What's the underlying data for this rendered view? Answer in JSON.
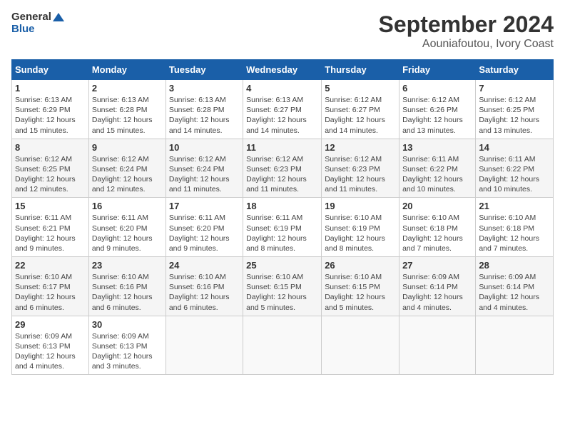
{
  "header": {
    "logo_line1": "General",
    "logo_line2": "Blue",
    "title": "September 2024",
    "subtitle": "Aouniafoutou, Ivory Coast"
  },
  "calendar": {
    "days_of_week": [
      "Sunday",
      "Monday",
      "Tuesday",
      "Wednesday",
      "Thursday",
      "Friday",
      "Saturday"
    ],
    "weeks": [
      [
        {
          "day": 1,
          "sunrise": "6:13 AM",
          "sunset": "6:29 PM",
          "daylight": "12 hours and 15 minutes."
        },
        {
          "day": 2,
          "sunrise": "6:13 AM",
          "sunset": "6:28 PM",
          "daylight": "12 hours and 15 minutes."
        },
        {
          "day": 3,
          "sunrise": "6:13 AM",
          "sunset": "6:28 PM",
          "daylight": "12 hours and 14 minutes."
        },
        {
          "day": 4,
          "sunrise": "6:13 AM",
          "sunset": "6:27 PM",
          "daylight": "12 hours and 14 minutes."
        },
        {
          "day": 5,
          "sunrise": "6:12 AM",
          "sunset": "6:27 PM",
          "daylight": "12 hours and 14 minutes."
        },
        {
          "day": 6,
          "sunrise": "6:12 AM",
          "sunset": "6:26 PM",
          "daylight": "12 hours and 13 minutes."
        },
        {
          "day": 7,
          "sunrise": "6:12 AM",
          "sunset": "6:25 PM",
          "daylight": "12 hours and 13 minutes."
        }
      ],
      [
        {
          "day": 8,
          "sunrise": "6:12 AM",
          "sunset": "6:25 PM",
          "daylight": "12 hours and 12 minutes."
        },
        {
          "day": 9,
          "sunrise": "6:12 AM",
          "sunset": "6:24 PM",
          "daylight": "12 hours and 12 minutes."
        },
        {
          "day": 10,
          "sunrise": "6:12 AM",
          "sunset": "6:24 PM",
          "daylight": "12 hours and 11 minutes."
        },
        {
          "day": 11,
          "sunrise": "6:12 AM",
          "sunset": "6:23 PM",
          "daylight": "12 hours and 11 minutes."
        },
        {
          "day": 12,
          "sunrise": "6:12 AM",
          "sunset": "6:23 PM",
          "daylight": "12 hours and 11 minutes."
        },
        {
          "day": 13,
          "sunrise": "6:11 AM",
          "sunset": "6:22 PM",
          "daylight": "12 hours and 10 minutes."
        },
        {
          "day": 14,
          "sunrise": "6:11 AM",
          "sunset": "6:22 PM",
          "daylight": "12 hours and 10 minutes."
        }
      ],
      [
        {
          "day": 15,
          "sunrise": "6:11 AM",
          "sunset": "6:21 PM",
          "daylight": "12 hours and 9 minutes."
        },
        {
          "day": 16,
          "sunrise": "6:11 AM",
          "sunset": "6:20 PM",
          "daylight": "12 hours and 9 minutes."
        },
        {
          "day": 17,
          "sunrise": "6:11 AM",
          "sunset": "6:20 PM",
          "daylight": "12 hours and 9 minutes."
        },
        {
          "day": 18,
          "sunrise": "6:11 AM",
          "sunset": "6:19 PM",
          "daylight": "12 hours and 8 minutes."
        },
        {
          "day": 19,
          "sunrise": "6:10 AM",
          "sunset": "6:19 PM",
          "daylight": "12 hours and 8 minutes."
        },
        {
          "day": 20,
          "sunrise": "6:10 AM",
          "sunset": "6:18 PM",
          "daylight": "12 hours and 7 minutes."
        },
        {
          "day": 21,
          "sunrise": "6:10 AM",
          "sunset": "6:18 PM",
          "daylight": "12 hours and 7 minutes."
        }
      ],
      [
        {
          "day": 22,
          "sunrise": "6:10 AM",
          "sunset": "6:17 PM",
          "daylight": "12 hours and 6 minutes."
        },
        {
          "day": 23,
          "sunrise": "6:10 AM",
          "sunset": "6:16 PM",
          "daylight": "12 hours and 6 minutes."
        },
        {
          "day": 24,
          "sunrise": "6:10 AM",
          "sunset": "6:16 PM",
          "daylight": "12 hours and 6 minutes."
        },
        {
          "day": 25,
          "sunrise": "6:10 AM",
          "sunset": "6:15 PM",
          "daylight": "12 hours and 5 minutes."
        },
        {
          "day": 26,
          "sunrise": "6:10 AM",
          "sunset": "6:15 PM",
          "daylight": "12 hours and 5 minutes."
        },
        {
          "day": 27,
          "sunrise": "6:09 AM",
          "sunset": "6:14 PM",
          "daylight": "12 hours and 4 minutes."
        },
        {
          "day": 28,
          "sunrise": "6:09 AM",
          "sunset": "6:14 PM",
          "daylight": "12 hours and 4 minutes."
        }
      ],
      [
        {
          "day": 29,
          "sunrise": "6:09 AM",
          "sunset": "6:13 PM",
          "daylight": "12 hours and 4 minutes."
        },
        {
          "day": 30,
          "sunrise": "6:09 AM",
          "sunset": "6:13 PM",
          "daylight": "12 hours and 3 minutes."
        },
        null,
        null,
        null,
        null,
        null
      ]
    ]
  }
}
